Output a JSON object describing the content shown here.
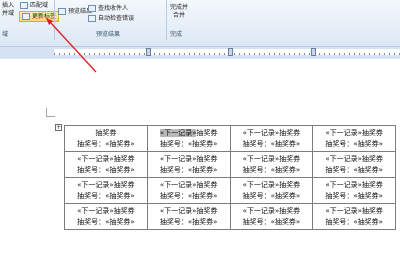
{
  "ribbon": {
    "insert_label_line1": "插入",
    "insert_label_line2": "并域",
    "matched_field_label": "匹配域",
    "update_labels_label": "更新标签",
    "preview_results_label": "预览结果",
    "find_recipient_label": "查找收件人",
    "auto_check_errors_label": "自动检查错误",
    "finish_merge_line1": "完成并",
    "finish_merge_line2": "合并",
    "group_write_insert": "域",
    "group_preview": "预览结果",
    "group_finish": "完成"
  },
  "table": {
    "rows": [
      [
        {
          "line1": "抽奖券",
          "line2": "抽奖号：«抽奖券»"
        },
        {
          "line1": "«下一记录»抽奖券",
          "line2": "抽奖号：«抽奖券»"
        },
        {
          "line1": "«下一记录»抽奖券",
          "line2": "抽奖号：«抽奖券»"
        },
        {
          "line1": "«下一记录»抽奖券",
          "line2": "抽奖号：«抽奖券»"
        }
      ],
      [
        {
          "line1": "«下一记录»抽奖券",
          "line2": "抽奖号：«抽奖券»"
        },
        {
          "line1": "«下一记录»抽奖券",
          "line2": "抽奖号：«抽奖券»"
        },
        {
          "line1": "«下一记录»抽奖券",
          "line2": "抽奖号：«抽奖券»"
        },
        {
          "line1": "«下一记录»抽奖券",
          "line2": "抽奖号：«抽奖券»"
        }
      ],
      [
        {
          "line1": "«下一记录»抽奖券",
          "line2": "抽奖号：«抽奖券»"
        },
        {
          "line1": "«下一记录»抽奖券",
          "line2": "抽奖号：«抽奖券»"
        },
        {
          "line1": "«下一记录»抽奖券",
          "line2": "抽奖号：«抽奖券»"
        },
        {
          "line1": "«下一记录»抽奖券",
          "line2": "抽奖号：«抽奖券»"
        }
      ],
      [
        {
          "line1": "«下一记录»抽奖券",
          "line2": "抽奖号：«抽奖券»"
        },
        {
          "line1": "«下一记录»抽奖券",
          "line2": "抽奖号：«抽奖券»"
        },
        {
          "line1": "«下一记录»抽奖券",
          "line2": "抽奖号：«抽奖券»"
        },
        {
          "line1": "«下一记录»抽奖券",
          "line2": "抽奖号：«抽奖券»"
        }
      ]
    ]
  },
  "colors": {
    "highlight_fill": "#ffd66b",
    "arrow": "#e02020",
    "selection": "#b9b9b9"
  }
}
